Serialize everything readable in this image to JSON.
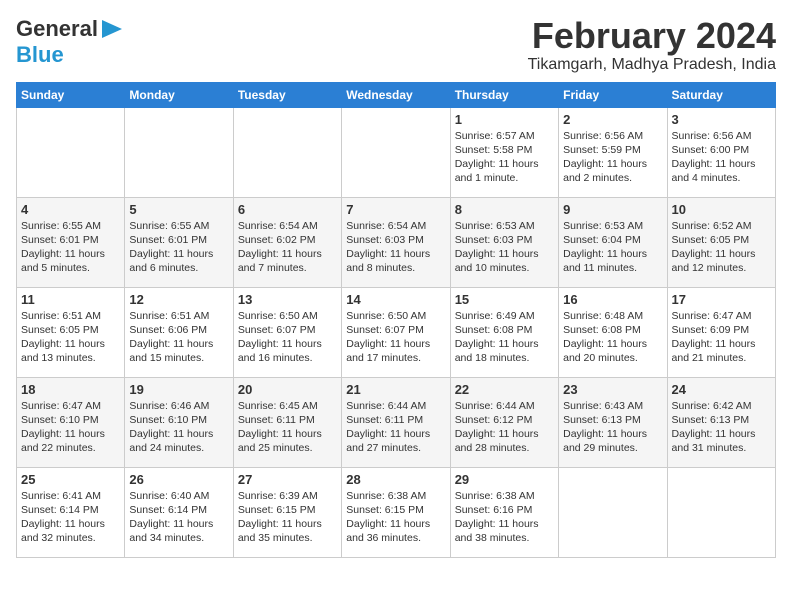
{
  "logo": {
    "line1": "General",
    "line2": "Blue"
  },
  "header": {
    "month": "February 2024",
    "location": "Tikamgarh, Madhya Pradesh, India"
  },
  "weekdays": [
    "Sunday",
    "Monday",
    "Tuesday",
    "Wednesday",
    "Thursday",
    "Friday",
    "Saturday"
  ],
  "weeks": [
    [
      {
        "day": "",
        "info": ""
      },
      {
        "day": "",
        "info": ""
      },
      {
        "day": "",
        "info": ""
      },
      {
        "day": "",
        "info": ""
      },
      {
        "day": "1",
        "info": "Sunrise: 6:57 AM\nSunset: 5:58 PM\nDaylight: 11 hours and 1 minute."
      },
      {
        "day": "2",
        "info": "Sunrise: 6:56 AM\nSunset: 5:59 PM\nDaylight: 11 hours and 2 minutes."
      },
      {
        "day": "3",
        "info": "Sunrise: 6:56 AM\nSunset: 6:00 PM\nDaylight: 11 hours and 4 minutes."
      }
    ],
    [
      {
        "day": "4",
        "info": "Sunrise: 6:55 AM\nSunset: 6:01 PM\nDaylight: 11 hours and 5 minutes."
      },
      {
        "day": "5",
        "info": "Sunrise: 6:55 AM\nSunset: 6:01 PM\nDaylight: 11 hours and 6 minutes."
      },
      {
        "day": "6",
        "info": "Sunrise: 6:54 AM\nSunset: 6:02 PM\nDaylight: 11 hours and 7 minutes."
      },
      {
        "day": "7",
        "info": "Sunrise: 6:54 AM\nSunset: 6:03 PM\nDaylight: 11 hours and 8 minutes."
      },
      {
        "day": "8",
        "info": "Sunrise: 6:53 AM\nSunset: 6:03 PM\nDaylight: 11 hours and 10 minutes."
      },
      {
        "day": "9",
        "info": "Sunrise: 6:53 AM\nSunset: 6:04 PM\nDaylight: 11 hours and 11 minutes."
      },
      {
        "day": "10",
        "info": "Sunrise: 6:52 AM\nSunset: 6:05 PM\nDaylight: 11 hours and 12 minutes."
      }
    ],
    [
      {
        "day": "11",
        "info": "Sunrise: 6:51 AM\nSunset: 6:05 PM\nDaylight: 11 hours and 13 minutes."
      },
      {
        "day": "12",
        "info": "Sunrise: 6:51 AM\nSunset: 6:06 PM\nDaylight: 11 hours and 15 minutes."
      },
      {
        "day": "13",
        "info": "Sunrise: 6:50 AM\nSunset: 6:07 PM\nDaylight: 11 hours and 16 minutes."
      },
      {
        "day": "14",
        "info": "Sunrise: 6:50 AM\nSunset: 6:07 PM\nDaylight: 11 hours and 17 minutes."
      },
      {
        "day": "15",
        "info": "Sunrise: 6:49 AM\nSunset: 6:08 PM\nDaylight: 11 hours and 18 minutes."
      },
      {
        "day": "16",
        "info": "Sunrise: 6:48 AM\nSunset: 6:08 PM\nDaylight: 11 hours and 20 minutes."
      },
      {
        "day": "17",
        "info": "Sunrise: 6:47 AM\nSunset: 6:09 PM\nDaylight: 11 hours and 21 minutes."
      }
    ],
    [
      {
        "day": "18",
        "info": "Sunrise: 6:47 AM\nSunset: 6:10 PM\nDaylight: 11 hours and 22 minutes."
      },
      {
        "day": "19",
        "info": "Sunrise: 6:46 AM\nSunset: 6:10 PM\nDaylight: 11 hours and 24 minutes."
      },
      {
        "day": "20",
        "info": "Sunrise: 6:45 AM\nSunset: 6:11 PM\nDaylight: 11 hours and 25 minutes."
      },
      {
        "day": "21",
        "info": "Sunrise: 6:44 AM\nSunset: 6:11 PM\nDaylight: 11 hours and 27 minutes."
      },
      {
        "day": "22",
        "info": "Sunrise: 6:44 AM\nSunset: 6:12 PM\nDaylight: 11 hours and 28 minutes."
      },
      {
        "day": "23",
        "info": "Sunrise: 6:43 AM\nSunset: 6:13 PM\nDaylight: 11 hours and 29 minutes."
      },
      {
        "day": "24",
        "info": "Sunrise: 6:42 AM\nSunset: 6:13 PM\nDaylight: 11 hours and 31 minutes."
      }
    ],
    [
      {
        "day": "25",
        "info": "Sunrise: 6:41 AM\nSunset: 6:14 PM\nDaylight: 11 hours and 32 minutes."
      },
      {
        "day": "26",
        "info": "Sunrise: 6:40 AM\nSunset: 6:14 PM\nDaylight: 11 hours and 34 minutes."
      },
      {
        "day": "27",
        "info": "Sunrise: 6:39 AM\nSunset: 6:15 PM\nDaylight: 11 hours and 35 minutes."
      },
      {
        "day": "28",
        "info": "Sunrise: 6:38 AM\nSunset: 6:15 PM\nDaylight: 11 hours and 36 minutes."
      },
      {
        "day": "29",
        "info": "Sunrise: 6:38 AM\nSunset: 6:16 PM\nDaylight: 11 hours and 38 minutes."
      },
      {
        "day": "",
        "info": ""
      },
      {
        "day": "",
        "info": ""
      }
    ]
  ]
}
